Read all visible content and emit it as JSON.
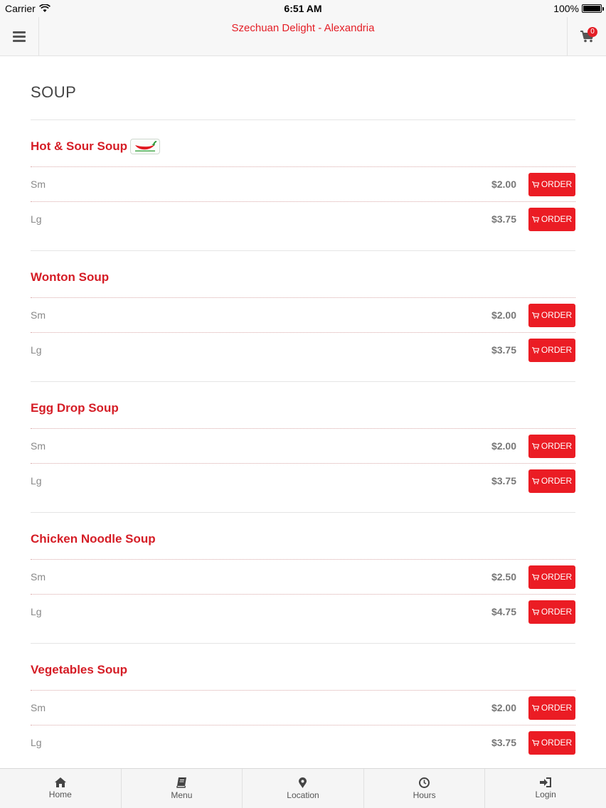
{
  "status_bar": {
    "carrier": "Carrier",
    "time": "6:51 AM",
    "battery": "100%"
  },
  "header": {
    "title": "Szechuan Delight - Alexandria",
    "cart_count": "0"
  },
  "section": {
    "title": "SOUP"
  },
  "items": [
    {
      "name": "Hot & Sour Soup",
      "spicy": true,
      "options": [
        {
          "size": "Sm",
          "price": "$2.00",
          "order": "ORDER"
        },
        {
          "size": "Lg",
          "price": "$3.75",
          "order": "ORDER"
        }
      ]
    },
    {
      "name": "Wonton Soup",
      "spicy": false,
      "options": [
        {
          "size": "Sm",
          "price": "$2.00",
          "order": "ORDER"
        },
        {
          "size": "Lg",
          "price": "$3.75",
          "order": "ORDER"
        }
      ]
    },
    {
      "name": "Egg Drop Soup",
      "spicy": false,
      "options": [
        {
          "size": "Sm",
          "price": "$2.00",
          "order": "ORDER"
        },
        {
          "size": "Lg",
          "price": "$3.75",
          "order": "ORDER"
        }
      ]
    },
    {
      "name": "Chicken Noodle Soup",
      "spicy": false,
      "options": [
        {
          "size": "Sm",
          "price": "$2.50",
          "order": "ORDER"
        },
        {
          "size": "Lg",
          "price": "$4.75",
          "order": "ORDER"
        }
      ]
    },
    {
      "name": "Vegetables Soup",
      "spicy": false,
      "options": [
        {
          "size": "Sm",
          "price": "$2.00",
          "order": "ORDER"
        },
        {
          "size": "Lg",
          "price": "$3.75",
          "order": "ORDER"
        }
      ]
    }
  ],
  "tabs": [
    {
      "label": "Home",
      "icon": "home-icon"
    },
    {
      "label": "Menu",
      "icon": "book-icon"
    },
    {
      "label": "Location",
      "icon": "map-marker-icon"
    },
    {
      "label": "Hours",
      "icon": "clock-icon"
    },
    {
      "label": "Login",
      "icon": "login-icon"
    }
  ],
  "colors": {
    "accent": "#e41e26",
    "button": "#eb1c24"
  }
}
